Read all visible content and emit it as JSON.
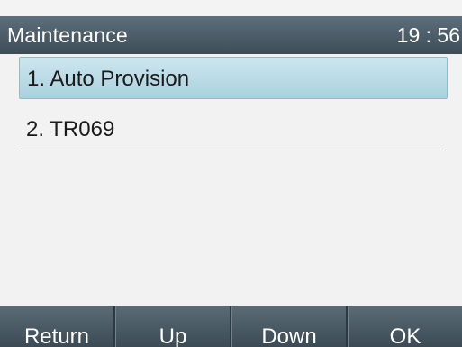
{
  "header": {
    "title": "Maintenance",
    "clock": "19 : 56"
  },
  "menu": {
    "items": [
      {
        "label": "1. Auto Provision",
        "selected": true
      },
      {
        "label": "2. TR069",
        "selected": false
      }
    ]
  },
  "softkeys": {
    "return": "Return",
    "up": "Up",
    "down": "Down",
    "ok": "OK"
  },
  "colors": {
    "header_bg": "#4d5d68",
    "selection_bg": "#bcdce6",
    "screen_bg": "#f2f2f2"
  }
}
